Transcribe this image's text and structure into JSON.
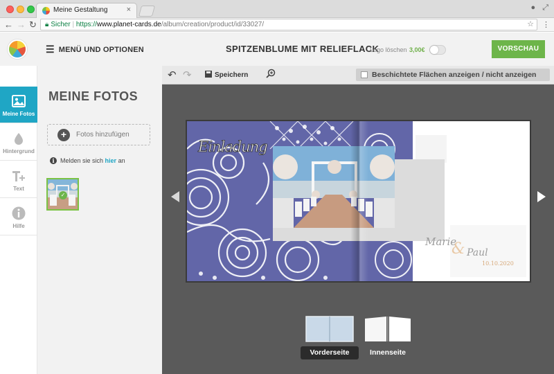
{
  "browser": {
    "tab_title": "Meine Gestaltung",
    "tab_close": "×",
    "secure_label": "Sicher",
    "url_scheme": "https://",
    "url_domain": "www.planet-cards.de",
    "url_path": "/album/creation/product/id/33027/"
  },
  "header": {
    "menu_label": "MENÜ UND OPTIONEN",
    "product_title": "SPITZENBLUME MIT RELIEFLACK",
    "logo_delete_label": "Logo löschen",
    "logo_delete_price": "3,00€",
    "logo_toggle_on": false,
    "preview_button": "VORSCHAU"
  },
  "sidebar": {
    "items": [
      {
        "label": "Meine Fotos",
        "icon": "image-icon",
        "active": true
      },
      {
        "label": "Hintergrund",
        "icon": "drop-icon",
        "active": false
      },
      {
        "label": "Text",
        "icon": "text-plus-icon",
        "active": false
      },
      {
        "label": "Hilfe",
        "icon": "info-icon",
        "active": false
      }
    ]
  },
  "panel": {
    "title": "MEINE FOTOS",
    "add_photos_label": "Fotos hinzufügen",
    "login_prefix": "Melden sie sich",
    "login_link": "hier",
    "login_suffix": "an"
  },
  "editor_toolbar": {
    "save_label": "Speichern",
    "coated_toggle_label": "Beschichtete Flächen anzeigen / nicht anzeigen"
  },
  "card": {
    "invitation_text": "Einladung",
    "name_1": "Marie",
    "ampersand": "&",
    "name_2": "Paul",
    "date": "10.10.2020"
  },
  "views": {
    "front_label": "Vorderseite",
    "inner_label": "Innenseite",
    "selected": "front"
  },
  "colors": {
    "accent_teal": "#1fa6c5",
    "preview_green": "#6db54a",
    "lace_blue": "#6266a8"
  }
}
